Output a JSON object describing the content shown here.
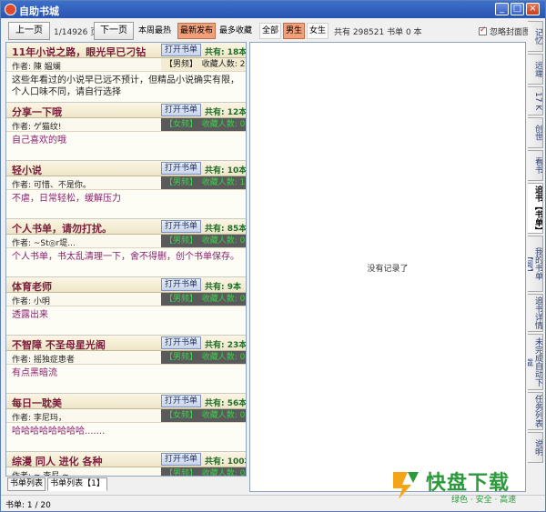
{
  "window": {
    "title": "自助书城"
  },
  "toolbar": {
    "prev_label": "上一页",
    "page_indicator": "1/14926 页",
    "next_label": "下一页",
    "filters": [
      {
        "label": "本周最热",
        "active": false
      },
      {
        "label": "最新发布",
        "active": true
      },
      {
        "label": "最多收藏",
        "active": false
      }
    ],
    "gender_filters": [
      {
        "label": "全部",
        "active": false
      },
      {
        "label": "男生",
        "active": true
      },
      {
        "label": "女生",
        "active": false
      }
    ],
    "total_text": "共有 298521 书单 0 本",
    "ignore_cover_label": "忽略封面图"
  },
  "lists": [
    {
      "name": "11年小说之路，眼光早已刁钻",
      "open": "打开书单",
      "total": "共有: 18本",
      "author": "作者: 陳 媼斓",
      "gender": "【男频】",
      "favorites": "收藏人数: 2",
      "desc": "这些年看过的小说早已远不预计，但精品小说确实有限，个人口味不同，请自行选择",
      "dark": true
    },
    {
      "name": "分享一下哦",
      "open": "打开书单",
      "total": "共有: 12本",
      "author": "作者: ゲ猫纹!",
      "gender": "【女频】",
      "favorites": "收藏人数: 0",
      "desc": "自己喜欢的哦",
      "dark": false
    },
    {
      "name": "轻小说",
      "open": "打开书单",
      "total": "共有: 10本",
      "author": "作者: 可惜、不是你。",
      "gender": "【男频】",
      "favorites": "收藏人数: 1",
      "desc": "不虐，日常轻松，缓解压力",
      "dark": false
    },
    {
      "name": "个人书单，请勿打扰。",
      "open": "打开书单",
      "total": "共有: 85本",
      "author": "作者: ~St◎r堤...",
      "gender": "【男频】",
      "favorites": "收藏人数: 0",
      "desc": "个人书单，书太乱清理一下，舍不得删，创个书单保存。",
      "dark": false
    },
    {
      "name": "体育老师",
      "open": "打开书单",
      "total": "共有: 9本",
      "author": "作者: 小明",
      "gender": "【男频】",
      "favorites": "收藏人数: 0",
      "desc": "透露出来",
      "dark": false
    },
    {
      "name": "不智障  不圣母星光阁",
      "open": "打开书单",
      "total": "共有: 23本",
      "author": "作者: 摇独症患者",
      "gender": "【男频】",
      "favorites": "收藏人数: 0",
      "desc": "有点黑暗流",
      "dark": false
    },
    {
      "name": "每日一耽美",
      "open": "打开书单",
      "total": "共有: 56本",
      "author": "作者: 李尼玛，",
      "gender": "【女频】",
      "favorites": "收藏人数: 0",
      "desc": "哈哈哈哈哈哈哈哈.......",
      "dark": false
    },
    {
      "name": "综漫 同人 进化 各种",
      "open": "打开书单",
      "total": "共有: 100本",
      "author": "作者: ≈ 李尼 ≈",
      "gender": "【男频】",
      "favorites": "收藏人数: 0",
      "desc": "",
      "dark": false
    }
  ],
  "bottom_tabs": [
    "书单列表",
    "书单列表【1】"
  ],
  "detail": {
    "empty_text": "没有记录了"
  },
  "side_tabs": [
    "记忆",
    "远端",
    "17 K",
    "创世",
    "看书",
    "追书【书单】",
    "我的书单【阅】",
    "追书详情",
    "未完成自动下载",
    "任务列表",
    "说明"
  ],
  "status": {
    "text": "书单: 1 / 20"
  },
  "watermark": {
    "brand": "快盘下载",
    "slogan": "绿色 · 安全 · 高速"
  }
}
